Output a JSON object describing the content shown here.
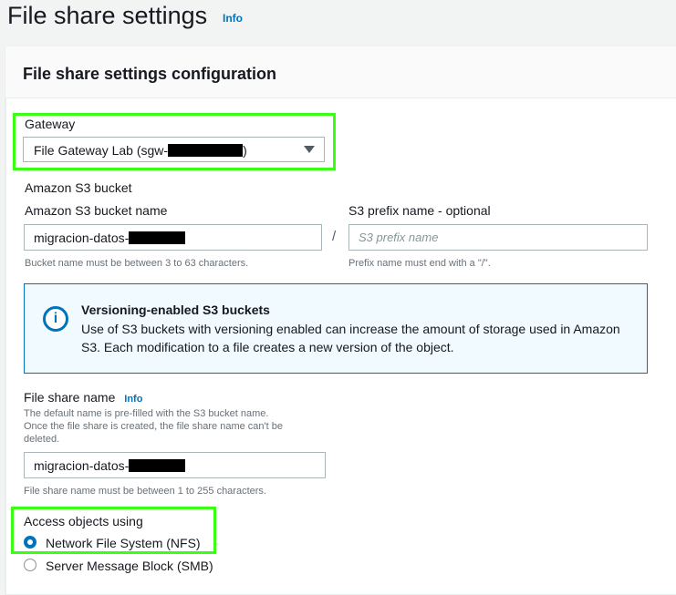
{
  "page": {
    "title": "File share settings",
    "info": "Info"
  },
  "panel": {
    "title": "File share settings configuration"
  },
  "gateway": {
    "label": "Gateway",
    "selected": "File Gateway Lab (sgw-",
    "selected_suffix": ")"
  },
  "s3": {
    "section_label": "Amazon S3 bucket",
    "bucket_label": "Amazon S3 bucket name",
    "bucket_value": "migracion-datos-",
    "bucket_hint": "Bucket name must be between 3 to 63 characters.",
    "separator": "/",
    "prefix_label": "S3 prefix name - optional",
    "prefix_placeholder": "S3 prefix name",
    "prefix_hint": "Prefix name must end with a \"/\"."
  },
  "alert": {
    "icon": "i",
    "title": "Versioning-enabled S3 buckets",
    "body": "Use of S3 buckets with versioning enabled can increase the amount of storage used in Amazon S3. Each modification to a file creates a new version of the object."
  },
  "file_share": {
    "label": "File share name",
    "info": "Info",
    "desc_line1": "The default name is pre-filled with the S3 bucket name.",
    "desc_line2": "Once the file share is created, the file share name can't be",
    "desc_line3": "deleted.",
    "value": "migracion-datos-",
    "hint": "File share name must be between 1 to 255 characters."
  },
  "access": {
    "label": "Access objects using",
    "options": [
      {
        "label": "Network File System (NFS)",
        "selected": true
      },
      {
        "label": "Server Message Block (SMB)",
        "selected": false
      }
    ]
  },
  "colors": {
    "accent": "#0073bb",
    "highlight": "#39ff14"
  }
}
